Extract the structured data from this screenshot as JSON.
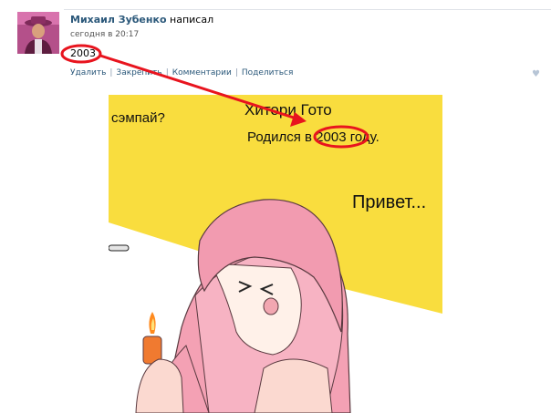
{
  "post": {
    "author": "Михаил Зубенко",
    "action": "написал",
    "date": "сегодня в 20:17",
    "text": "2003"
  },
  "actions": {
    "delete": "Удалить",
    "pin": "Закрепить",
    "comments": "Комментарии",
    "share": "Поделиться"
  },
  "image_text": {
    "sempai": "сэмпай?",
    "name": "Хитори Гото",
    "born": "Родился в 2003 году.",
    "hello": "Привет..."
  },
  "colors": {
    "author_link": "#2b587a",
    "annotation_red": "#e8141e",
    "image_background": "#f9dd3e",
    "hair_pink": "#f4a1b4"
  }
}
